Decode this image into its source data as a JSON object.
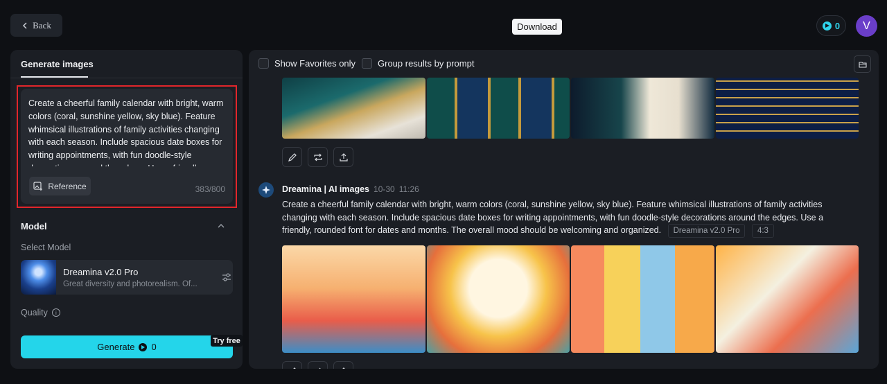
{
  "topbar": {
    "back_label": "Back",
    "download_tooltip": "Download",
    "credits": "0",
    "avatar_letter": "V"
  },
  "left_panel": {
    "tab_label": "Generate images",
    "prompt_text": "Create a cheerful family calendar with bright, warm colors (coral, sunshine yellow, sky blue). Feature whimsical illustrations of family activities changing with each season. Include spacious date boxes for writing appointments, with fun doodle-style decorations around the edges. Use a friendly, rounded font for dates and months. The overall mood should be welcoming and organized.",
    "reference_label": "Reference",
    "char_count": "383/800",
    "model_heading": "Model",
    "select_model_label": "Select Model",
    "model_name": "Dreamina v2.0 Pro",
    "model_desc": "Great diversity and photorealism. Of...",
    "quality_label": "Quality",
    "generate_label": "Generate",
    "generate_credits": "0",
    "try_free_badge": "Try free"
  },
  "results": {
    "show_favorites_label": "Show Favorites only",
    "group_by_prompt_label": "Group results by prompt",
    "generation": {
      "author": "Dreamina | AI images",
      "date": "10-30",
      "time": "11:26",
      "prompt": "Create a cheerful family calendar with bright, warm colors (coral, sunshine yellow, sky blue). Feature whimsical illustrations of family activities changing with each season. Include spacious date boxes for writing appointments, with fun doodle-style decorations around the edges. Use a friendly, rounded font for dates and months. The overall mood should be welcoming and organized.",
      "model_tag": "Dreamina v2.0 Pro",
      "ratio_tag": "4:3"
    }
  },
  "colors": {
    "accent": "#24d5ea",
    "highlight_border": "#e2262b",
    "avatar_bg": "#6a3ec9"
  }
}
